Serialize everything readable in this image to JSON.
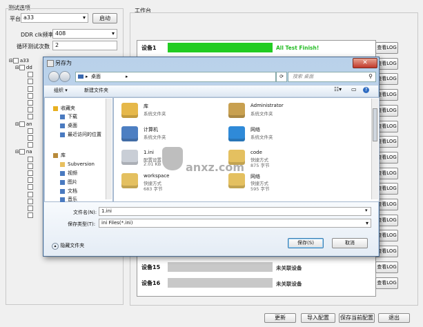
{
  "left_panel": {
    "title": "测试选项",
    "platform_label": "平台",
    "platform_value": "a33",
    "start_label": "启动",
    "ddr_label": "DDR clk频率",
    "ddr_value": "408",
    "loop_label": "循环测试次数",
    "loop_value": "2",
    "tree_root": "a33",
    "tree_items": [
      "dd",
      "",
      "",
      "",
      "",
      "",
      "",
      "",
      "an",
      "",
      "",
      "",
      "na",
      "",
      "",
      "",
      "",
      "",
      "",
      "",
      "",
      ""
    ]
  },
  "workbench": {
    "title": "工作台",
    "rows": [
      {
        "label": "设备1",
        "status": "All Test Finish!",
        "log": "查看LOG",
        "bar": "green"
      },
      {
        "label": "",
        "status": "",
        "log": "查看LOG",
        "bar": "gray"
      },
      {
        "label": "",
        "status": "",
        "log": "查看LOG",
        "bar": "gray"
      },
      {
        "label": "",
        "status": "",
        "log": "查看LOG",
        "bar": "gray"
      },
      {
        "label": "",
        "status": "",
        "log": "查看LOG",
        "bar": "gray"
      },
      {
        "label": "",
        "status": "",
        "log": "查看LOG",
        "bar": "gray"
      },
      {
        "label": "",
        "status": "",
        "log": "查看LOG",
        "bar": "gray"
      },
      {
        "label": "",
        "status": "",
        "log": "查看LOG",
        "bar": "gray"
      },
      {
        "label": "",
        "status": "",
        "log": "查看LOG",
        "bar": "gray"
      },
      {
        "label": "",
        "status": "",
        "log": "查看LOG",
        "bar": "gray"
      },
      {
        "label": "",
        "status": "",
        "log": "查看LOG",
        "bar": "gray"
      },
      {
        "label": "",
        "status": "",
        "log": "查看LOG",
        "bar": "gray"
      },
      {
        "label": "",
        "status": "",
        "log": "查看LOG",
        "bar": "gray"
      },
      {
        "label": "",
        "status": "",
        "log": "查看LOG",
        "bar": "gray"
      },
      {
        "label": "设备15",
        "status": "未关联设备",
        "log": "查看LOG",
        "bar": "gray"
      },
      {
        "label": "设备16",
        "status": "未关联设备",
        "log": "查看LOG",
        "bar": "gray"
      }
    ],
    "colors": {
      "progress_green": "#22cc22",
      "status_green": "#22bb22",
      "bar_gray": "#c8c8c8"
    }
  },
  "bottom_buttons": {
    "refresh": "更新",
    "import": "导入配置",
    "save_current": "保存当前配置",
    "exit": "退出"
  },
  "dialog": {
    "title": "另存为",
    "path_label": "桌面",
    "path_sep": "▸",
    "search_placeholder": "搜索 桌面",
    "organize": "组织 ▾",
    "new_folder": "新建文件夹",
    "sidebar": [
      {
        "label": "收藏夹",
        "icon": "star-icon"
      },
      {
        "label": "下载",
        "icon": "download-icon"
      },
      {
        "label": "桌面",
        "icon": "desktop-icon"
      },
      {
        "label": "最近访问的位置",
        "icon": "recent-icon"
      },
      {
        "label": "库",
        "icon": "library-icon"
      },
      {
        "label": "Subversion",
        "icon": "folder-icon"
      },
      {
        "label": "视频",
        "icon": "video-icon"
      },
      {
        "label": "图片",
        "icon": "picture-icon"
      },
      {
        "label": "文档",
        "icon": "document-icon"
      },
      {
        "label": "音乐",
        "icon": "music-icon"
      }
    ],
    "files": [
      {
        "name": "库",
        "sub": "系统文件夹",
        "icon": "library-folder-icon"
      },
      {
        "name": "Administrator",
        "sub": "系统文件夹",
        "icon": "user-folder-icon"
      },
      {
        "name": "计算机",
        "sub": "系统文件夹",
        "icon": "computer-icon"
      },
      {
        "name": "网络",
        "sub": "系统文件夹",
        "icon": "network-icon"
      },
      {
        "name": "1.ini",
        "sub1": "配置设置",
        "sub2": "2.01 KB",
        "icon": "ini-file-icon"
      },
      {
        "name": "code",
        "sub1": "快捷方式",
        "sub2": "875 字节",
        "icon": "shortcut-icon"
      },
      {
        "name": "workspace",
        "sub1": "快捷方式",
        "sub2": "683 字节",
        "icon": "shortcut-icon"
      },
      {
        "name": "网络",
        "sub1": "快捷方式",
        "sub2": "595 字节",
        "icon": "shortcut-icon"
      }
    ],
    "filename_label": "文件名(N):",
    "filename_value": "1.ini",
    "filetype_label": "保存类型(T):",
    "filetype_value": "ini Files(*.ini)",
    "hide_folders": "隐藏文件夹",
    "save": "保存(S)",
    "cancel": "取消",
    "watermark": "anxz.com"
  }
}
